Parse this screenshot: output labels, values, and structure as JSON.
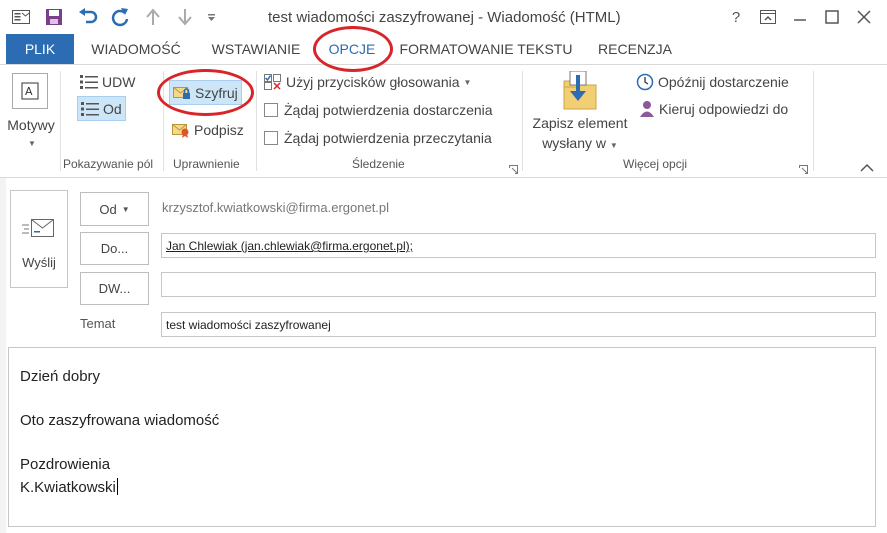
{
  "window": {
    "title": "test wiadomości zaszyfrowanej - Wiadomość (HTML)",
    "help_label": "?"
  },
  "tabs": [
    {
      "label": "PLIK"
    },
    {
      "label": "WIADOMOŚĆ"
    },
    {
      "label": "WSTAWIANIE"
    },
    {
      "label": "OPCJE"
    },
    {
      "label": "FORMATOWANIE TEKSTU"
    },
    {
      "label": "RECENZJA"
    }
  ],
  "ribbon": {
    "motywy": {
      "label": "Motywy"
    },
    "pokazywanie_pol": {
      "group_label": "Pokazywanie pól",
      "udw_label": "UDW",
      "od_label": "Od"
    },
    "uprawnienie": {
      "group_label": "Uprawnienie",
      "szyfruj_label": "Szyfruj",
      "podpisz_label": "Podpisz"
    },
    "sledzenie": {
      "group_label": "Śledzenie",
      "glosowanie_label": "Użyj przycisków głosowania",
      "dostarczenie_label": "Żądaj potwierdzenia dostarczenia",
      "przeczytanie_label": "Żądaj potwierdzenia przeczytania"
    },
    "wiecej_opcji": {
      "group_label": "Więcej opcji",
      "zapisz_line1": "Zapisz element",
      "zapisz_line2": "wysłany w",
      "opoznij_label": "Opóźnij dostarczenie",
      "kieruj_label": "Kieruj odpowiedzi do"
    }
  },
  "header": {
    "send_label": "Wyślij",
    "from_button": "Od",
    "from_address": "krzysztof.kwiatkowski@firma.ergonet.pl",
    "to_button": "Do...",
    "to_value": "Jan Chlewiak (jan.chlewiak@firma.ergonet.pl);",
    "cc_button": "DW...",
    "cc_value": "",
    "subject_label": "Temat",
    "subject_value": "test wiadomości zaszyfrowanej"
  },
  "body": {
    "lines": [
      "Dzień dobry",
      "Oto zaszyfrowana wiadomość",
      "Pozdrowienia",
      "K.Kwiatkowski"
    ]
  },
  "colors": {
    "accent": "#2b6cb3",
    "highlight_ring": "#d8252a",
    "selected_button": "#cde6f7"
  }
}
